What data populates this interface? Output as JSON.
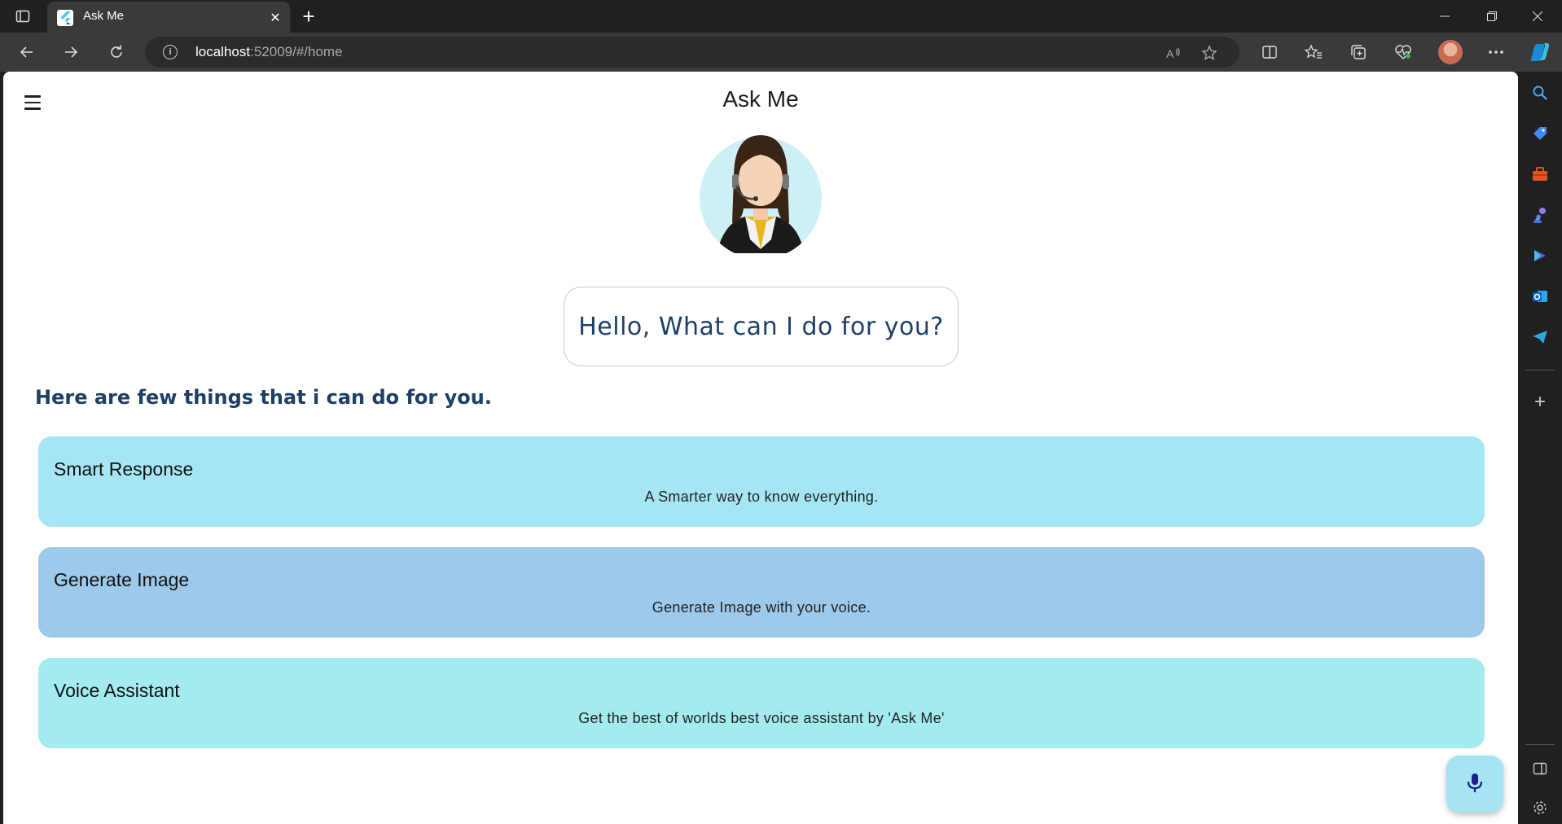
{
  "browser": {
    "tab_title": "Ask Me",
    "url_host": "localhost",
    "url_rest": ":52009/#/home"
  },
  "app": {
    "title": "Ask Me",
    "greeting": "Hello, What can I do for you?",
    "section_heading": "Here are few things that i can do for you.",
    "features": [
      {
        "title": "Smart Response",
        "description": "A Smarter way to know everything.",
        "color": "#a6e6f4"
      },
      {
        "title": "Generate Image",
        "description": "Generate Image with your voice.",
        "color": "#9dc9ea"
      },
      {
        "title": "Voice Assistant",
        "description": "Get the best of worlds best voice assistant by 'Ask Me'",
        "color": "#a3ebee"
      }
    ],
    "fab_icon": "mic-icon"
  },
  "colors": {
    "heading": "#1e3f66",
    "fab_bg": "#a6e4f1"
  }
}
